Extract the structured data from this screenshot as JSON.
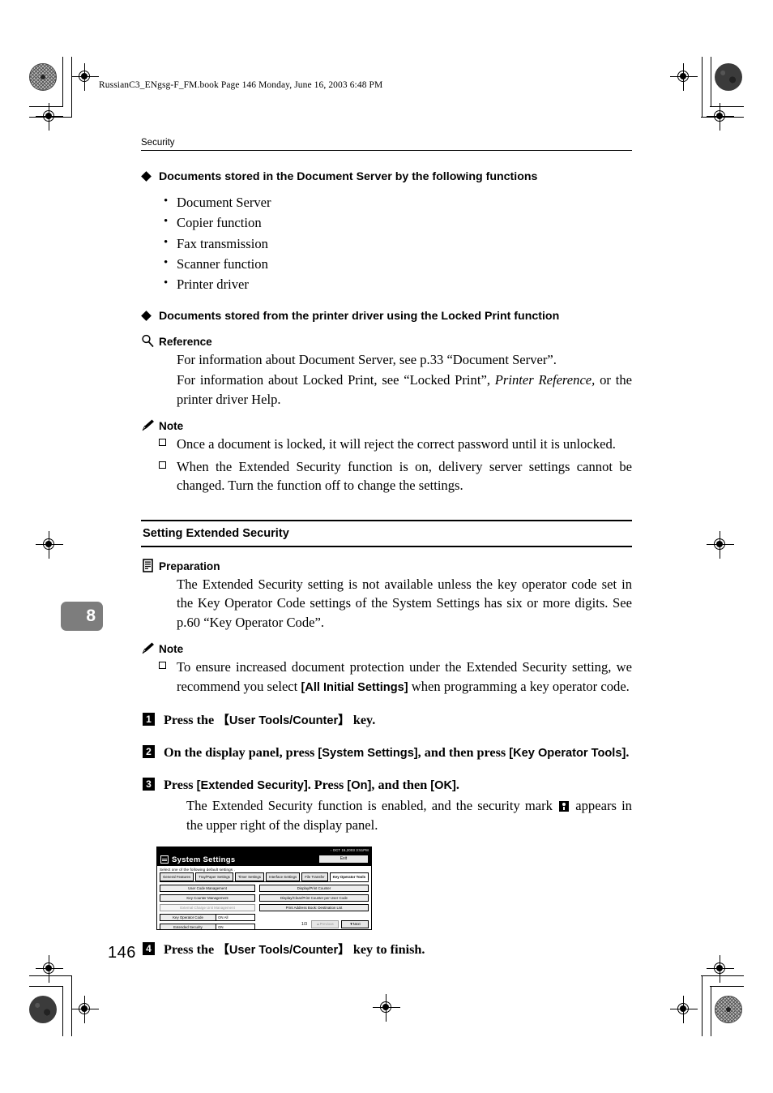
{
  "file_line": "RussianC3_ENgsg-F_FM.book  Page 146  Monday, June 16, 2003  6:48 PM",
  "running_head": "Security",
  "chapter_tab": "8",
  "page_number": "146",
  "sections": {
    "diamond_head_1": "Documents stored in the Document Server by the following functions",
    "bullets": [
      "Document Server",
      "Copier function",
      "Fax transmission",
      "Scanner function",
      "Printer driver"
    ],
    "diamond_head_2": "Documents stored from the printer driver using the Locked Print function",
    "reference_label": "Reference",
    "reference_paras": [
      "For information about Document Server, see p.33 “Document Server”.",
      "For information about Locked Print, see “Locked Print”, "
    ],
    "reference_italic": "Printer Reference,",
    "reference_tail": "or the printer driver Help.",
    "note_label": "Note",
    "notes": [
      "Once a document is locked, it will reject the correct password until it is unlocked.",
      "When the Extended Security function is on, delivery server settings cannot be changed. Turn the function off to change the settings."
    ],
    "section_title": "Setting Extended Security",
    "preparation_label": "Preparation",
    "preparation_text": "The Extended Security setting is not available unless the key operator code set in the Key Operator Code settings of the System Settings has six or more digits. See p.60 “Key Operator Code”.",
    "note2_label": "Note",
    "note2_parts": {
      "lead": "To ensure increased document protection under the Extended Security setting, we recommend you select ",
      "gui": "[All Initial Settings]",
      "tail": " when programming a key operator code."
    },
    "steps": [
      {
        "num": "1",
        "parts": {
          "pre": "Press the ",
          "gui": "【User Tools/Counter】",
          "post": " key."
        }
      },
      {
        "num": "2",
        "parts": {
          "pre": "On the display panel, press ",
          "gui": "[System Settings]",
          "mid": ", and then press ",
          "gui2": "[Key Operator Tools]",
          "post": "."
        }
      },
      {
        "num": "3",
        "parts": {
          "pre": "Press ",
          "gui": "[Extended Security]",
          "mid": ". Press ",
          "gui2": "[On]",
          "mid2": ", and then ",
          "gui3": "[OK]",
          "post": "."
        },
        "body_pre": "The Extended Security function is enabled, and the security mark ",
        "body_post": " appears in the upper right of the display panel."
      },
      {
        "num": "4",
        "parts": {
          "pre": "Press the ",
          "gui": "【User Tools/Counter】",
          "post": " key to finish."
        }
      }
    ]
  },
  "lcd": {
    "status_bar": "◦ OCT  15,2003  3:51PM",
    "title": "System Settings",
    "exit_label": "Exit",
    "instruction": "Select one of the following default settings .",
    "tabs": [
      "General Features",
      "Tray/Paper Settings",
      "Timer Settings",
      "Interface Settings",
      "File Transfer",
      "Key Operator Tools"
    ],
    "active_tab": "Key Operator Tools",
    "left_buttons": [
      {
        "label": "User Code Management",
        "value": null,
        "dim": false
      },
      {
        "label": "Key Counter Management",
        "value": null,
        "dim": false
      },
      {
        "label": "External Charge Unit Management",
        "value": null,
        "dim": true
      },
      {
        "label": "Key Operator Code",
        "value": "ON All",
        "dim": false
      },
      {
        "label": "Extended Security",
        "value": "ON",
        "dim": false
      }
    ],
    "right_buttons": [
      "Display/Print Counter",
      "Display/Clear/Print Counter per User Code",
      "Print Address Book: Destination List"
    ],
    "page_indicator": "1/3",
    "prev_label": "▲Previous",
    "next_label": "▼Next"
  }
}
